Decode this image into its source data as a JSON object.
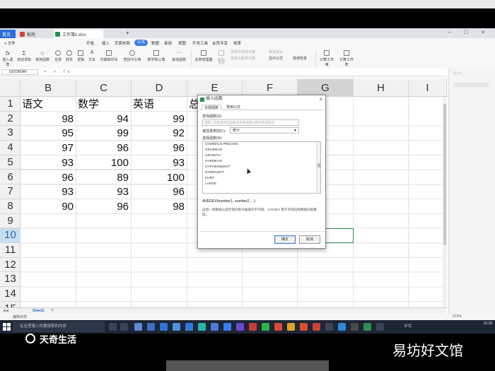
{
  "app": {
    "tabs": [
      {
        "label": "首页"
      },
      {
        "label": "稻壳"
      },
      {
        "label": "工作簿1.xlsx"
      }
    ],
    "menu": [
      "开始",
      "插入",
      "页面布局",
      "公式",
      "数据",
      "审阅",
      "视图",
      "开发工具",
      "会员专享",
      "效率"
    ],
    "active_menu": "公式",
    "ribbon": [
      "插入函数",
      "自动求和",
      "常用函数",
      "全部",
      "财务",
      "逻辑",
      "文本",
      "日期和时间",
      "查找与引用",
      "数学和三角",
      "其他函数",
      "名称管理器",
      "粘贴",
      "指定",
      "追踪引用单元格",
      "追踪从属单元格",
      "移去箭头",
      "显示公式",
      "错误检查",
      "计算工作簿",
      "计算工作表"
    ]
  },
  "formula_bar": {
    "name_box": "GDCBEAR",
    "icons": "× ✓ fx"
  },
  "columns": [
    "B",
    "C",
    "D",
    "E",
    "F",
    "G",
    "H",
    "I"
  ],
  "rows": [
    "1",
    "2",
    "3",
    "4",
    "5",
    "6",
    "7",
    "8",
    "9",
    "10",
    "11",
    "12",
    "13",
    "14",
    "15"
  ],
  "headers": {
    "B": "语文",
    "C": "数学",
    "D": "英语",
    "E": "总"
  },
  "table": [
    {
      "b": "98",
      "c": "94",
      "d": "99"
    },
    {
      "b": "95",
      "c": "99",
      "d": "92"
    },
    {
      "b": "97",
      "c": "96",
      "d": "96"
    },
    {
      "b": "93",
      "c": "100",
      "d": "93"
    },
    {
      "b": "96",
      "c": "89",
      "d": "100"
    },
    {
      "b": "93",
      "c": "93",
      "d": "96"
    },
    {
      "b": "90",
      "c": "96",
      "d": "98"
    }
  ],
  "sheet": {
    "tab": "Sheet1",
    "add": "+"
  },
  "status": {
    "left": "编辑状态",
    "zoom": "273%"
  },
  "taskbar": {
    "search": "在这里输入你要搜索的内容",
    "weather": "6°C",
    "time": "15:38"
  },
  "dialog": {
    "title": "插入函数",
    "tabs": [
      "全部函数",
      "常用公式"
    ],
    "search_label": "查找函数(S):",
    "search_placeholder": "请输入您要查找的函数名称或函数功能的简要描述",
    "category_label": "或选择类别(C):",
    "category_value": "统计",
    "list_label": "选择函数(N):",
    "functions": [
      "GAMMALN.PRECISE",
      "GEOMEAN",
      "GROWTH",
      "HARMEAN",
      "HYPGEOMDIST",
      "INTERCEPT",
      "KURT",
      "LARGE"
    ],
    "syntax": "AVEDEV(number1, number2, ...)",
    "description": "返回一组数据与其均值的绝对偏差的平均值。AVEDEV 用于评测这组数据的离散度。",
    "ok": "确定",
    "cancel": "取消"
  },
  "caption": {
    "logo": "天奇生活",
    "watermark": "易坊好文馆"
  }
}
